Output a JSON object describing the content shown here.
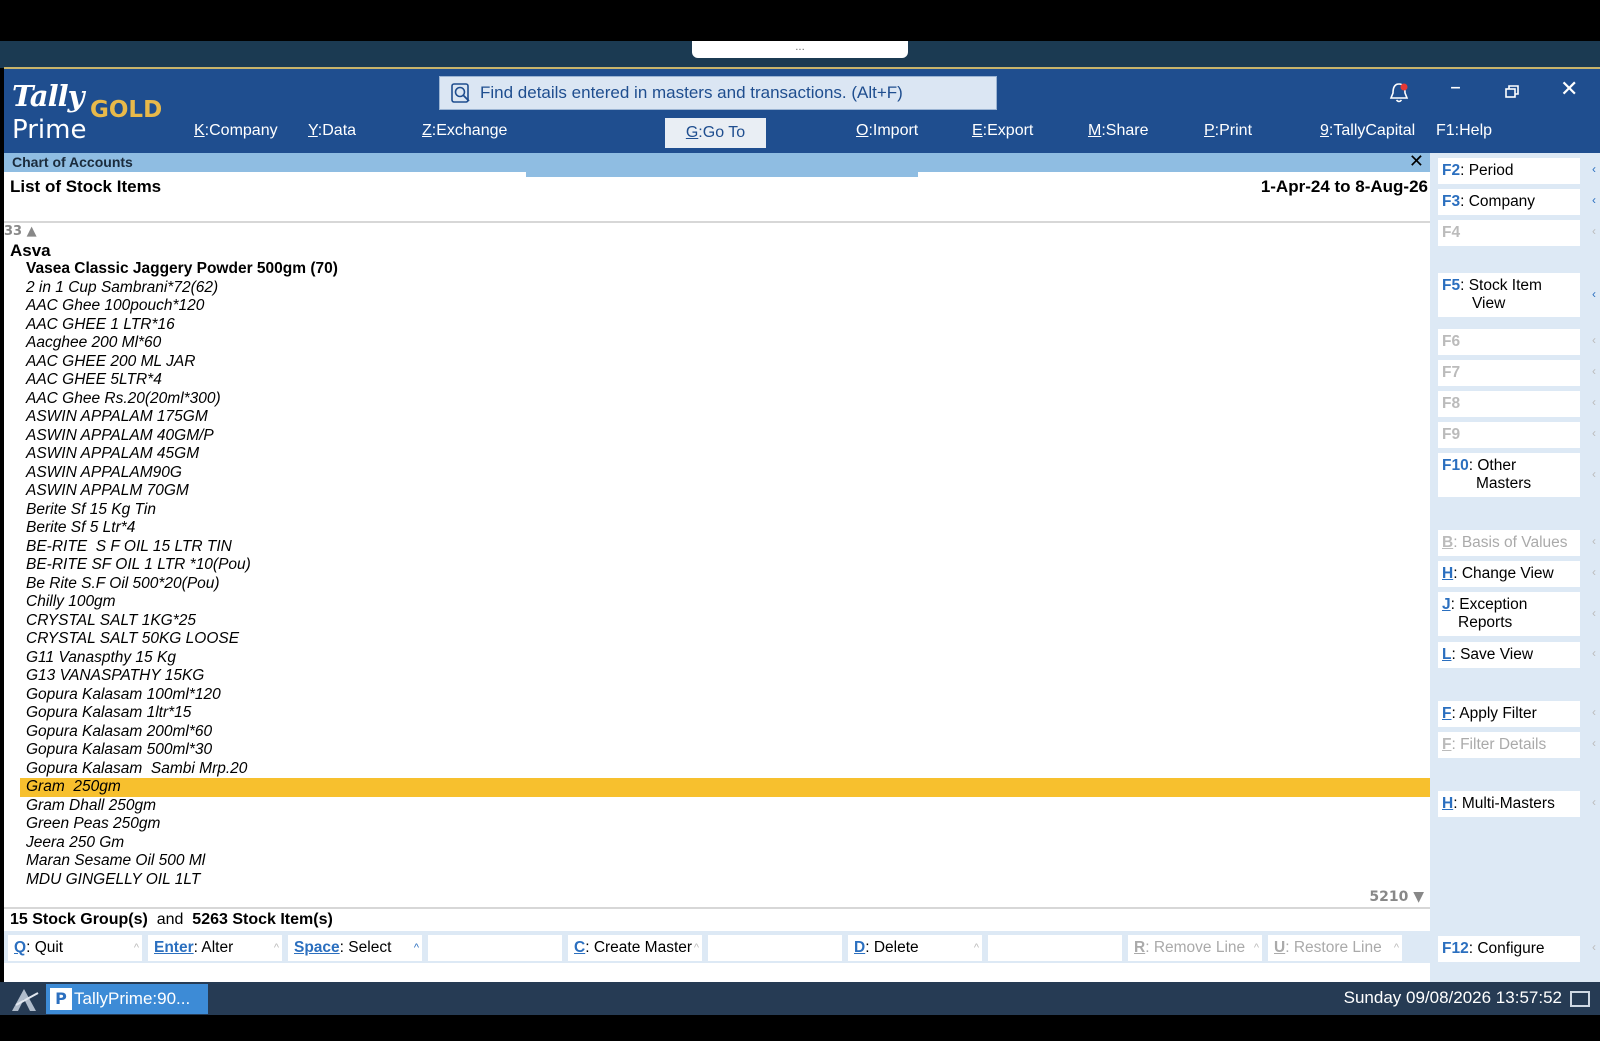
{
  "window": {
    "logo_tally": "Tally",
    "logo_prime": "Prime",
    "logo_edition": "GOLD",
    "search_text": "Find details entered in masters and transactions. (Alt+F)",
    "drag_handle": "..."
  },
  "menu": {
    "company": {
      "key": "K",
      "label": "Company"
    },
    "data": {
      "key": "Y",
      "label": "Data"
    },
    "exchange": {
      "key": "Z",
      "label": "Exchange"
    },
    "goto": {
      "key": "G",
      "label": "Go To"
    },
    "import": {
      "key": "O",
      "label": "Import"
    },
    "export": {
      "key": "E",
      "label": "Export"
    },
    "share": {
      "key": "M",
      "label": "Share"
    },
    "print": {
      "key": "P",
      "label": "Print"
    },
    "tallycapital": {
      "key": "9",
      "label": "TallyCapital"
    },
    "help": {
      "key": "F1",
      "label": "Help"
    }
  },
  "screen": {
    "breadcrumb": "Chart of Accounts",
    "title": "List of Stock Items",
    "period": "1-Apr-24 to 8-Aug-26",
    "count_top": "33",
    "count_bottom": "5210",
    "group": "Asva",
    "summary_groups": "15 Stock Group(s)",
    "summary_and": "and",
    "summary_items": "5263 Stock Item(s)"
  },
  "items": [
    {
      "name": "Vasea Classic Jaggery Powder 500gm (70)",
      "type": "head"
    },
    {
      "name": "2 in 1 Cup Sambrani*72(62)",
      "type": "item"
    },
    {
      "name": "AAC Ghee 100pouch*120",
      "type": "item"
    },
    {
      "name": "AAC GHEE 1 LTR*16",
      "type": "item"
    },
    {
      "name": "Aacghee 200 Ml*60",
      "type": "item"
    },
    {
      "name": "AAC GHEE 200 ML JAR",
      "type": "item"
    },
    {
      "name": "AAC GHEE 5LTR*4",
      "type": "item"
    },
    {
      "name": "AAC Ghee Rs.20(20ml*300)",
      "type": "item"
    },
    {
      "name": "ASWIN APPALAM 175GM",
      "type": "item"
    },
    {
      "name": "ASWIN APPALAM 40GM/P",
      "type": "item"
    },
    {
      "name": "ASWIN APPALAM 45GM",
      "type": "item"
    },
    {
      "name": "ASWIN APPALAM90G",
      "type": "item"
    },
    {
      "name": "ASWIN APPALM 70GM",
      "type": "item"
    },
    {
      "name": "Berite Sf 15 Kg Tin",
      "type": "item"
    },
    {
      "name": "Berite Sf 5 Ltr*4",
      "type": "item"
    },
    {
      "name": "BE-RITE  S F OIL 15 LTR TIN",
      "type": "item"
    },
    {
      "name": "BE-RITE SF OIL 1 LTR *10(Pou)",
      "type": "item"
    },
    {
      "name": "Be Rite S.F Oil 500*20(Pou)",
      "type": "item"
    },
    {
      "name": "Chilly 100gm",
      "type": "item"
    },
    {
      "name": "CRYSTAL SALT 1KG*25",
      "type": "item"
    },
    {
      "name": "CRYSTAL SALT 50KG LOOSE",
      "type": "item"
    },
    {
      "name": "G11 Vanaspthy 15 Kg",
      "type": "item"
    },
    {
      "name": "G13 VANASPATHY 15KG",
      "type": "item"
    },
    {
      "name": "Gopura Kalasam 100ml*120",
      "type": "item"
    },
    {
      "name": "Gopura Kalasam 1ltr*15",
      "type": "item"
    },
    {
      "name": "Gopura Kalasam 200ml*60",
      "type": "item"
    },
    {
      "name": "Gopura Kalasam 500ml*30",
      "type": "item"
    },
    {
      "name": "Gopura Kalasam  Sambi Mrp.20",
      "type": "item"
    },
    {
      "name": "Gram  250gm",
      "type": "selected"
    },
    {
      "name": "Gram Dhall 250gm",
      "type": "item"
    },
    {
      "name": "Green Peas 250gm",
      "type": "item"
    },
    {
      "name": "Jeera 250 Gm",
      "type": "item"
    },
    {
      "name": "Maran Sesame Oil 500 Ml",
      "type": "item"
    },
    {
      "name": "MDU GINGELLY OIL 1LT",
      "type": "item"
    }
  ],
  "bottom_buttons": {
    "quit": {
      "key": "Q",
      "label": "Quit"
    },
    "alter": {
      "key": "Enter",
      "label": "Alter"
    },
    "select": {
      "key": "Space",
      "label": "Select"
    },
    "create": {
      "key": "C",
      "label": "Create Master"
    },
    "delete": {
      "key": "D",
      "label": "Delete"
    },
    "remove": {
      "key": "R",
      "label": "Remove Line"
    },
    "restore": {
      "key": "U",
      "label": "Restore Line"
    },
    "configure": {
      "key": "F12",
      "label": "Configure"
    }
  },
  "side_buttons": {
    "f2": {
      "key": "F2",
      "label": "Period"
    },
    "f3": {
      "key": "F3",
      "label": "Company"
    },
    "f4": {
      "key": "F4",
      "label": ""
    },
    "f5": {
      "key": "F5",
      "label": "Stock Item",
      "label2": "View"
    },
    "f6": {
      "key": "F6",
      "label": ""
    },
    "f7": {
      "key": "F7",
      "label": ""
    },
    "f8": {
      "key": "F8",
      "label": ""
    },
    "f9": {
      "key": "F9",
      "label": ""
    },
    "f10": {
      "key": "F10",
      "label": "Other",
      "label2": "Masters"
    },
    "basis": {
      "key": "B",
      "label": "Basis of Values"
    },
    "change": {
      "key": "H",
      "label": "Change View"
    },
    "exception": {
      "key": "J",
      "label": "Exception",
      "label2": "Reports"
    },
    "save": {
      "key": "L",
      "label": "Save View"
    },
    "apply": {
      "key": "F",
      "label": "Apply Filter"
    },
    "filter": {
      "key": "F",
      "label": "Filter Details"
    },
    "multi": {
      "key": "H",
      "label": "Multi-Masters"
    }
  },
  "taskbar": {
    "app_label": "TallyPrime:90...",
    "app_icon": "P",
    "clock": "Sunday 09/08/2026 13:57:52"
  },
  "colors": {
    "titlebar": "#1f4e8f",
    "subbar": "#8fbde2",
    "selected_row": "#f7c02e",
    "side_panel": "#dde9f5",
    "key_accent": "#2b6fbf",
    "gold": "#e8b94a"
  }
}
